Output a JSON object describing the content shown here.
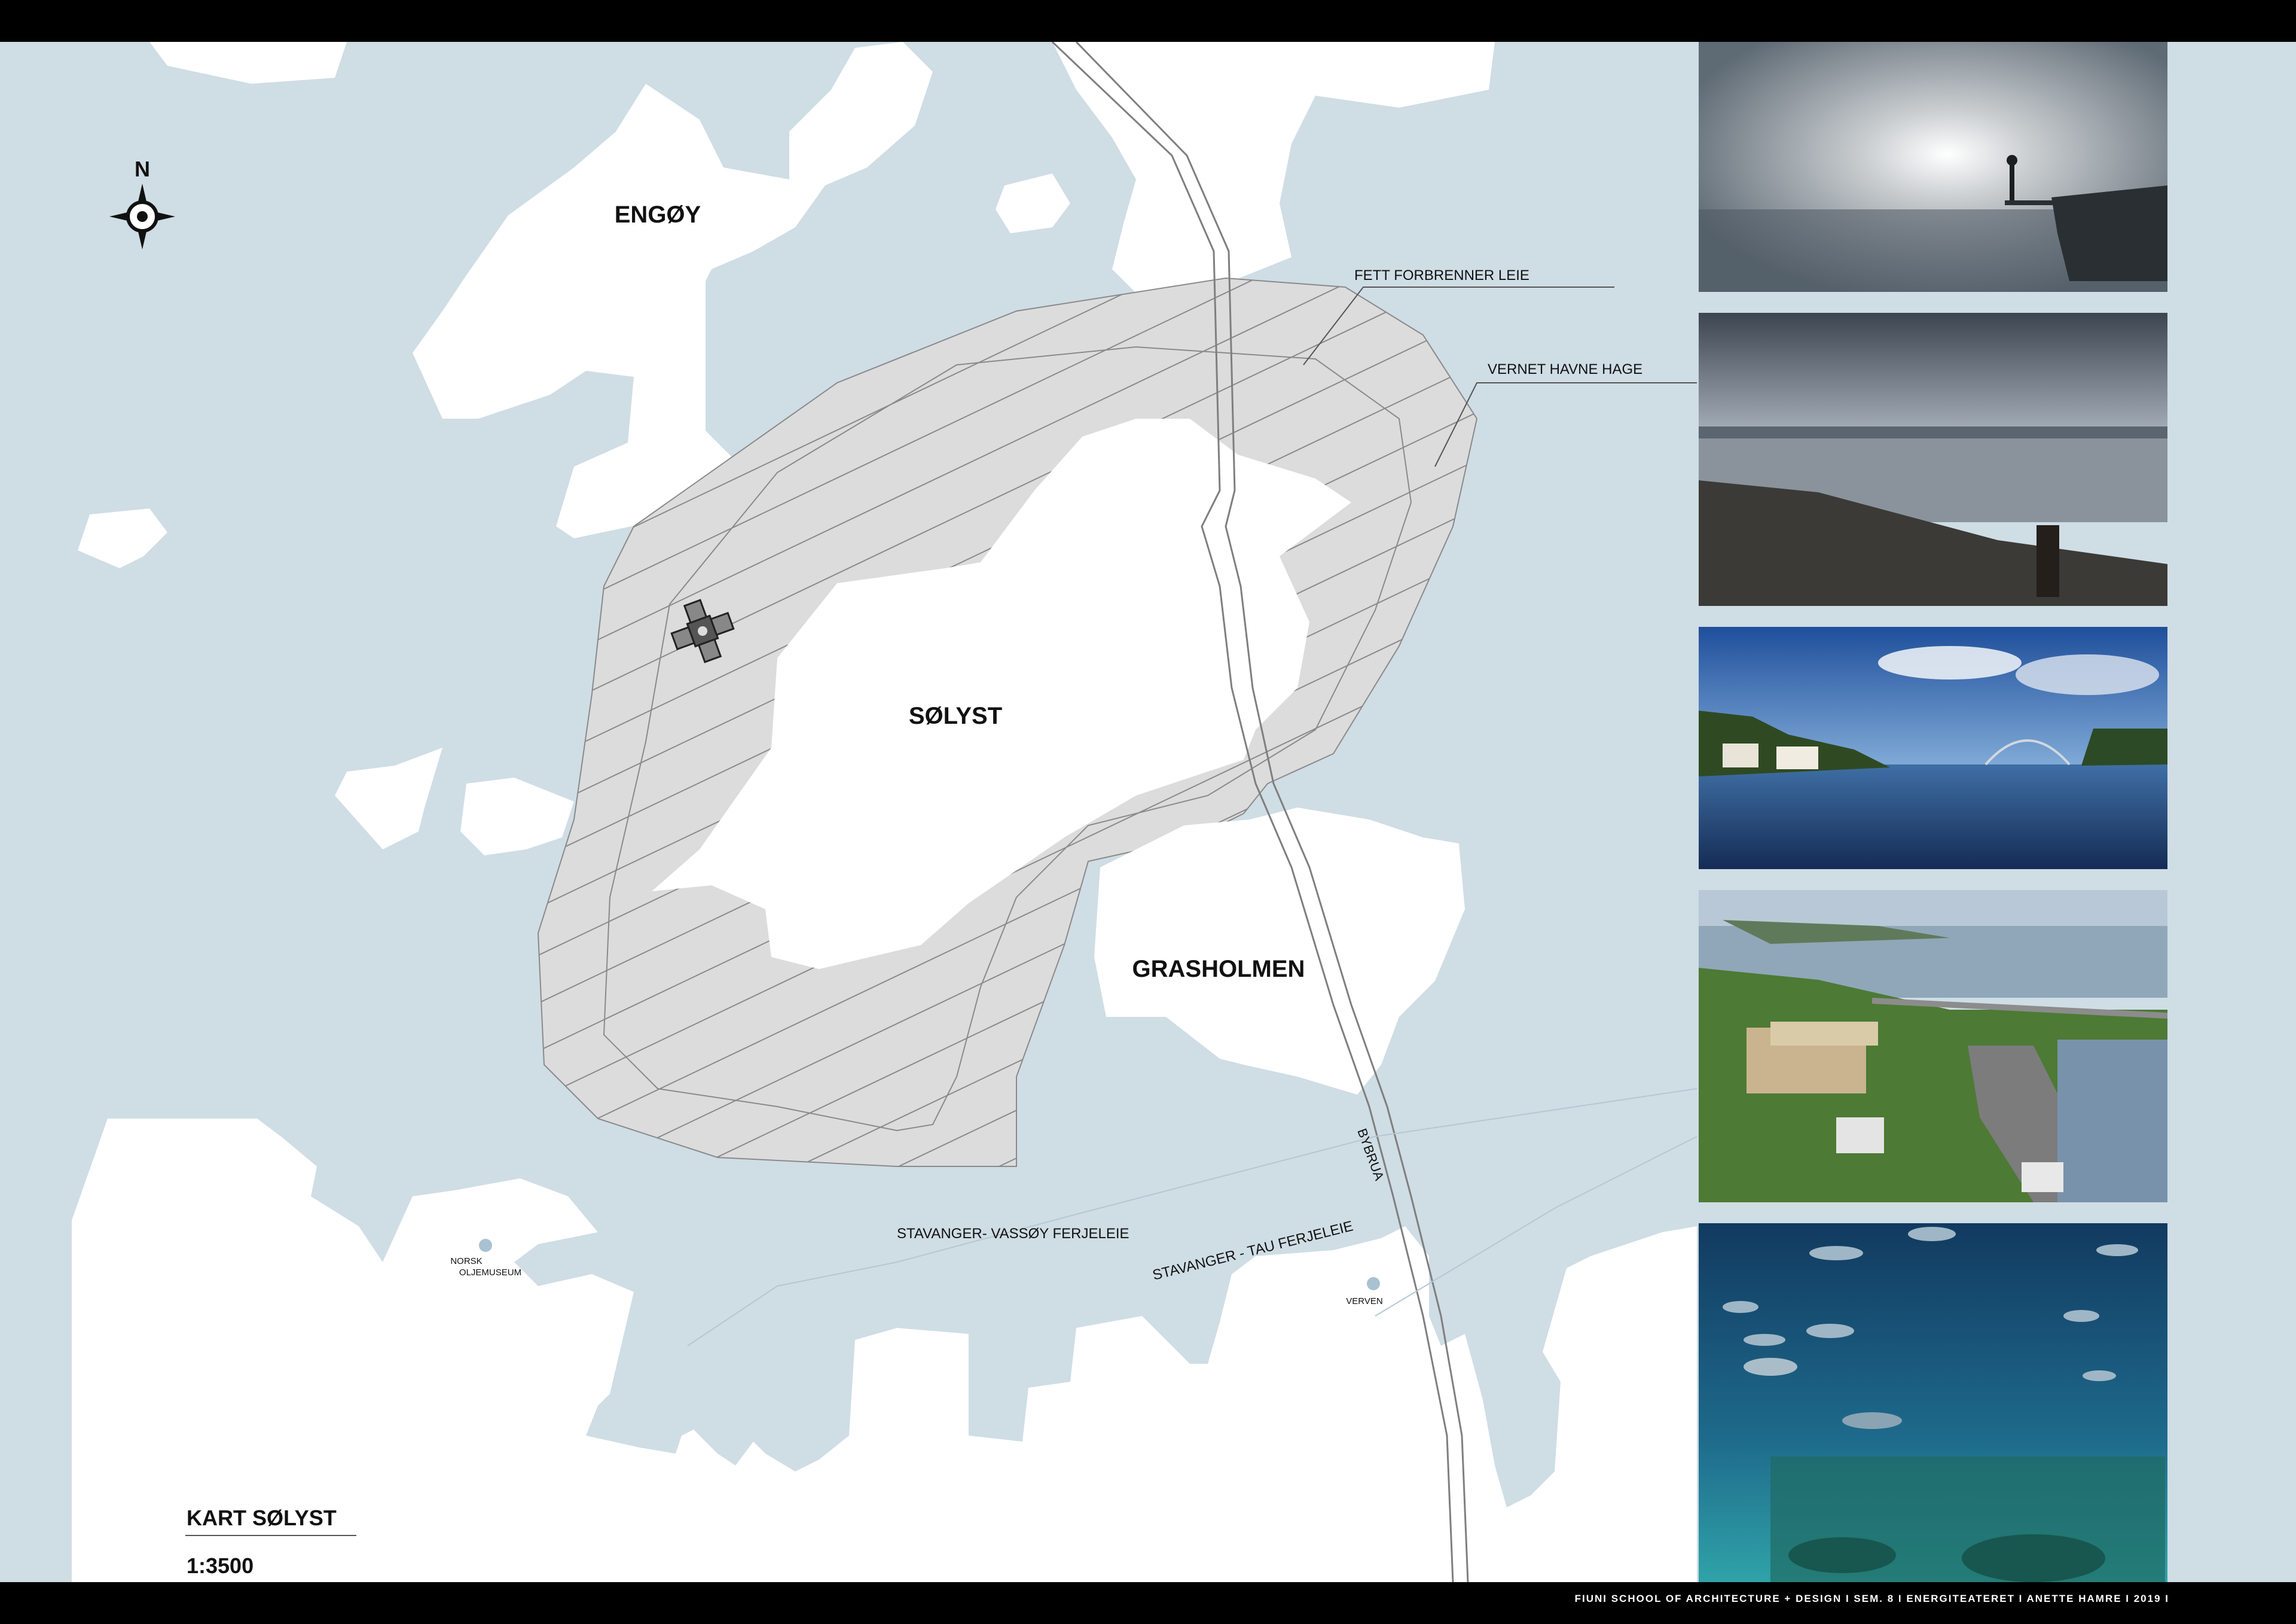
{
  "map": {
    "colors": {
      "water": "#cfdde5",
      "land": "#ffffff",
      "zone": "#dcdcdc",
      "line": "#7f7f7f",
      "text": "#111111"
    },
    "north_label": "N",
    "places": [
      {
        "id": "engoy",
        "label": "ENGØY"
      },
      {
        "id": "solyst",
        "label": "SØLYST"
      },
      {
        "id": "grasholmen",
        "label": "GRASHOLMEN"
      }
    ],
    "road_label": "BYBRUA",
    "annotations": {
      "fett": "FETT FORBRENNER LEIE",
      "vernet": "VERNET HAVNE HAGE"
    },
    "ferries": {
      "vassoy": "STAVANGER- VASSØY FERJELEIE",
      "tau": "STAVANGER - TAU FERJELEIE"
    },
    "poi": {
      "museum_line1": "NORSK",
      "museum_line2": "OLJEMUSEUM",
      "verven": "VERVEN"
    },
    "title": "KART SØLYST",
    "scale": "1:3500"
  },
  "photos": [
    {
      "id": "fog-pier",
      "icon": "photo-fog-figure-on-pier"
    },
    {
      "id": "harbour-longexposure",
      "icon": "photo-harbour-long-exposure"
    },
    {
      "id": "waterfront-bridge",
      "icon": "photo-waterfront-bridge"
    },
    {
      "id": "aerial-housing",
      "icon": "photo-aerial-housing-marina"
    },
    {
      "id": "aquarium",
      "icon": "photo-aquarium-fish"
    }
  ],
  "footer": {
    "credit": "FIUNI SCHOOL OF ARCHITECTURE + DESIGN I SEM. 8 I ENERGITEATERET I ANETTE HAMRE I 2019 I"
  }
}
